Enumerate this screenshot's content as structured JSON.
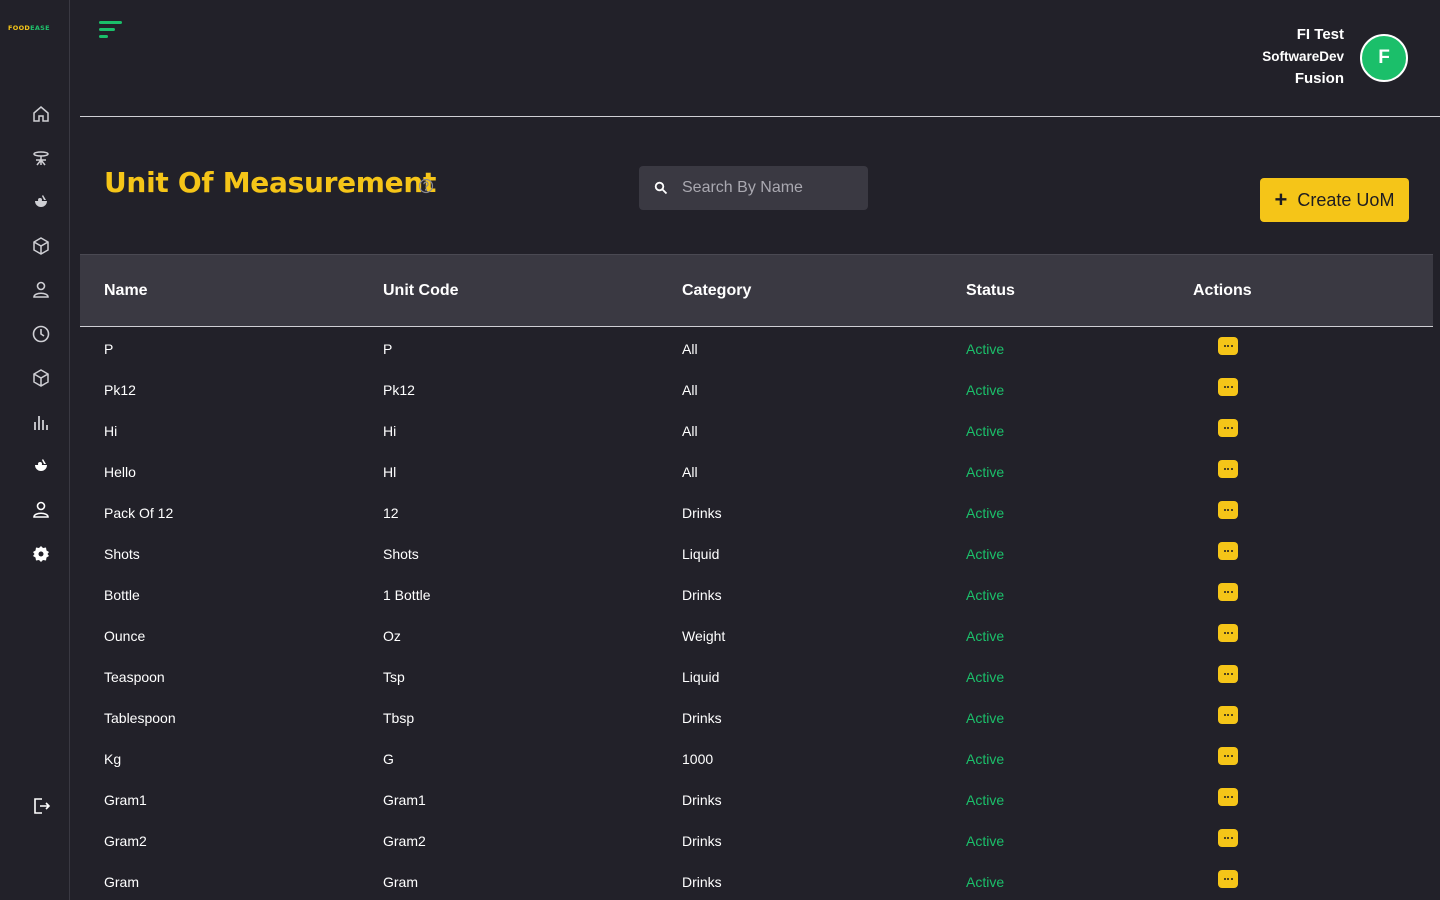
{
  "app": {
    "logo_part1": "FOOD",
    "logo_part2": "EASE"
  },
  "sidebar": {
    "items": [
      {
        "icon": "home-icon"
      },
      {
        "icon": "table-icon"
      },
      {
        "icon": "food-icon"
      },
      {
        "icon": "box-icon"
      },
      {
        "icon": "user-icon"
      },
      {
        "icon": "clock-icon"
      },
      {
        "icon": "package-icon"
      },
      {
        "icon": "chart-icon"
      },
      {
        "icon": "food-active-icon"
      },
      {
        "icon": "person-icon"
      },
      {
        "icon": "settings-icon"
      }
    ],
    "logout_icon": "logout-icon"
  },
  "header": {
    "user_line1": "FI Test",
    "user_line2": "SoftwareDev",
    "user_line3": "Fusion",
    "avatar_letter": "F"
  },
  "page": {
    "title": "Unit Of Measurement",
    "search_placeholder": "Search By Name",
    "create_label": "Create UoM"
  },
  "table": {
    "columns": [
      "Name",
      "Unit Code",
      "Category",
      "Status",
      "Actions"
    ],
    "rows": [
      {
        "name": "P",
        "code": "P",
        "category": "All",
        "status": "Active"
      },
      {
        "name": "Pk12",
        "code": "Pk12",
        "category": "All",
        "status": "Active"
      },
      {
        "name": "Hi",
        "code": "Hi",
        "category": "All",
        "status": "Active"
      },
      {
        "name": "Hello",
        "code": "Hl",
        "category": "All",
        "status": "Active"
      },
      {
        "name": "Pack Of 12",
        "code": "12",
        "category": "Drinks",
        "status": "Active"
      },
      {
        "name": "Shots",
        "code": "Shots",
        "category": "Liquid",
        "status": "Active"
      },
      {
        "name": "Bottle",
        "code": "1 Bottle",
        "category": "Drinks",
        "status": "Active"
      },
      {
        "name": "Ounce",
        "code": "Oz",
        "category": "Weight",
        "status": "Active"
      },
      {
        "name": "Teaspoon",
        "code": "Tsp",
        "category": "Liquid",
        "status": "Active"
      },
      {
        "name": "Tablespoon",
        "code": "Tbsp",
        "category": "Drinks",
        "status": "Active"
      },
      {
        "name": "Kg",
        "code": "G",
        "category": "1000",
        "status": "Active"
      },
      {
        "name": "Gram1",
        "code": "Gram1",
        "category": "Drinks",
        "status": "Active"
      },
      {
        "name": "Gram2",
        "code": "Gram2",
        "category": "Drinks",
        "status": "Active"
      },
      {
        "name": "Gram",
        "code": "Gram",
        "category": "Drinks",
        "status": "Active"
      }
    ]
  },
  "colors": {
    "accent": "#f5c518",
    "success": "#1bbf6a",
    "background": "#222129",
    "header_row": "#3a3942"
  }
}
